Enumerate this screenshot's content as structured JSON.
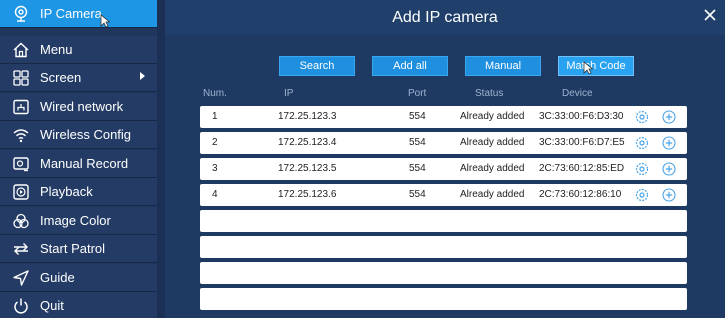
{
  "sidebar": {
    "items": [
      {
        "label": "IP Camera",
        "icon": "camera-icon"
      },
      {
        "label": "Menu",
        "icon": "home-icon"
      },
      {
        "label": "Screen",
        "icon": "grid-icon"
      },
      {
        "label": "Wired network",
        "icon": "monitor-icon"
      },
      {
        "label": "Wireless Config",
        "icon": "wifi-icon"
      },
      {
        "label": "Manual Record",
        "icon": "record-icon"
      },
      {
        "label": "Playback",
        "icon": "playback-icon"
      },
      {
        "label": "Image Color",
        "icon": "color-icon"
      },
      {
        "label": "Start Patrol",
        "icon": "patrol-icon"
      },
      {
        "label": "Guide",
        "icon": "guide-icon"
      },
      {
        "label": "Quit",
        "icon": "power-icon"
      }
    ]
  },
  "dialog": {
    "title": "Add IP camera",
    "close": "✕",
    "buttons": {
      "search": "Search",
      "add_all": "Add all",
      "manual": "Manual",
      "match_code": "Match Code"
    },
    "columns": {
      "num": "Num.",
      "ip": "IP",
      "port": "Port",
      "status": "Status",
      "device": "Device"
    },
    "rows": [
      {
        "num": "1",
        "ip": "172.25.123.3",
        "port": "554",
        "status": "Already added",
        "device": "3C:33:00:F6:D3:30"
      },
      {
        "num": "2",
        "ip": "172.25.123.4",
        "port": "554",
        "status": "Already added",
        "device": "3C:33:00:F6:D7:E5"
      },
      {
        "num": "3",
        "ip": "172.25.123.5",
        "port": "554",
        "status": "Already added",
        "device": "2C:73:60:12:85:ED"
      },
      {
        "num": "4",
        "ip": "172.25.123.6",
        "port": "554",
        "status": "Already added",
        "device": "2C:73:60:12:86:10"
      }
    ]
  },
  "colors": {
    "accent": "#1e96e6",
    "button": "#1f8fe0",
    "background": "#1b3054",
    "sidebar": "#243c65"
  }
}
